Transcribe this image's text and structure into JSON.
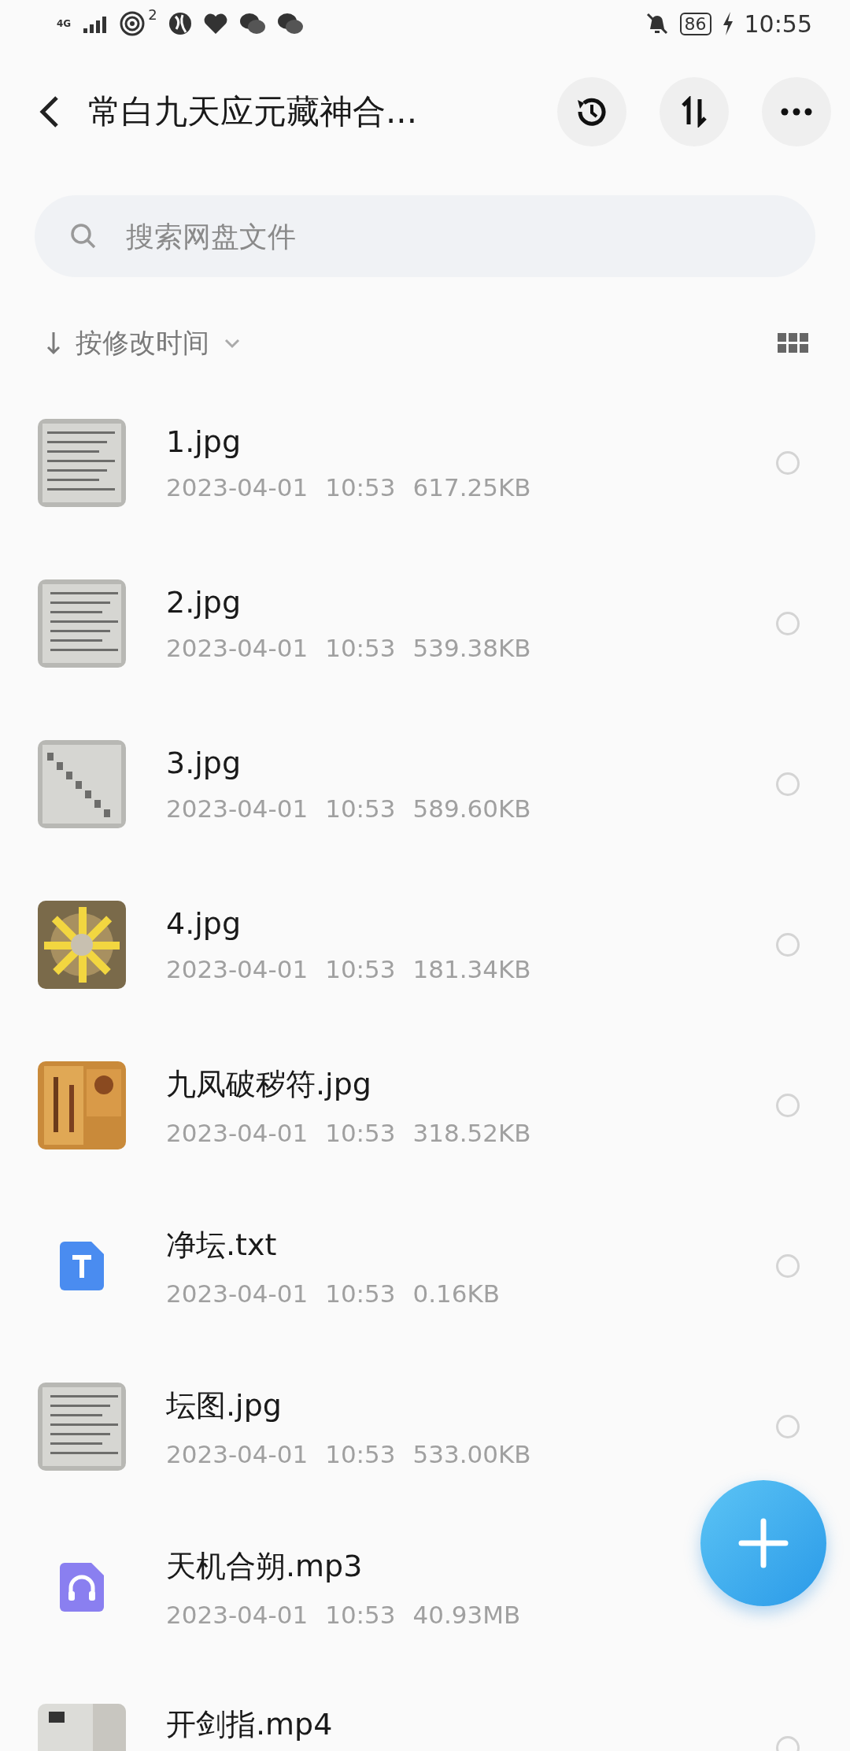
{
  "status_bar": {
    "network": "4G",
    "hotspot_count": "2",
    "battery": "86",
    "time": "10:55"
  },
  "header": {
    "title": "常白九天应元藏神合..."
  },
  "search": {
    "placeholder": "搜索网盘文件"
  },
  "sort": {
    "label": "按修改时间"
  },
  "files": [
    {
      "name": "1.jpg",
      "date": "2023-04-01",
      "time": "10:53",
      "size": "617.25KB",
      "kind": "picture",
      "selected": false
    },
    {
      "name": "2.jpg",
      "date": "2023-04-01",
      "time": "10:53",
      "size": "539.38KB",
      "kind": "picture",
      "selected": false
    },
    {
      "name": "3.jpg",
      "date": "2023-04-01",
      "time": "10:53",
      "size": "589.60KB",
      "kind": "picture",
      "selected": false
    },
    {
      "name": "4.jpg",
      "date": "2023-04-01",
      "time": "10:53",
      "size": "181.34KB",
      "kind": "picture",
      "selected": false
    },
    {
      "name": "九凤破秽符.jpg",
      "date": "2023-04-01",
      "time": "10:53",
      "size": "318.52KB",
      "kind": "picture",
      "selected": false
    },
    {
      "name": "净坛.txt",
      "date": "2023-04-01",
      "time": "10:53",
      "size": "0.16KB",
      "kind": "text",
      "selected": false
    },
    {
      "name": "坛图.jpg",
      "date": "2023-04-01",
      "time": "10:53",
      "size": "533.00KB",
      "kind": "picture",
      "selected": false
    },
    {
      "name": "天机合朔.mp3",
      "date": "2023-04-01",
      "time": "10:53",
      "size": "40.93MB",
      "kind": "audio"
    },
    {
      "name": "开剑指.mp4",
      "kind": "picture",
      "selected": false
    }
  ]
}
